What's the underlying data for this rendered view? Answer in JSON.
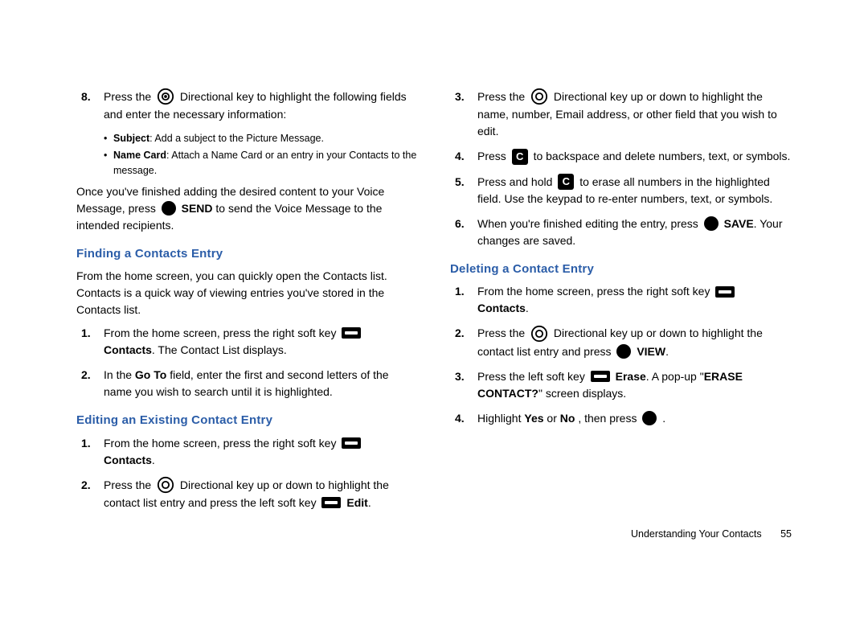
{
  "left": {
    "step8": {
      "num": "8.",
      "t1": "Press the ",
      "t2": " Directional key to highlight the following fields and enter the necessary information:"
    },
    "bullets": {
      "subj_b": "Subject",
      "subj": ": Add a subject to the Picture Message.",
      "nc_b": "Name Card",
      "nc": ": Attach a Name Card or an entry in your Contacts to the message."
    },
    "afterBullets": {
      "t1": "Once you've finished adding the desired content to your Voice Message, press ",
      "send": "SEND",
      "t2": " to send the Voice Message to the intended recipients."
    },
    "h1": "Finding a Contacts Entry",
    "p1": "From the home screen, you can quickly open the Contacts list. Contacts is a quick way of viewing entries you've stored in the Contacts list.",
    "find1": {
      "num": "1.",
      "t1": "From the home screen, press the right soft key ",
      "contacts": "Contacts",
      "t2": ". The Contact List displays."
    },
    "find2": {
      "num": "2.",
      "t1": "In the ",
      "goto": "Go To",
      "t2": " field, enter the first and second letters of the name you wish to search until it is highlighted."
    },
    "h2": "Editing an Existing Contact Entry",
    "edit1": {
      "num": "1.",
      "t1": "From the home screen, press the right soft key ",
      "contacts": "Contacts",
      "t2": "."
    },
    "edit2": {
      "num": "2.",
      "t1": "Press the ",
      "t2": " Directional key up or down to highlight the contact list entry and press the left soft key ",
      "edit": "Edit",
      "t3": "."
    }
  },
  "right": {
    "r3": {
      "num": "3.",
      "t1": "Press the ",
      "t2": " Directional key up or down to highlight the name, number, Email address, or other field that you wish to edit."
    },
    "r4": {
      "num": "4.",
      "t1": "Press ",
      "t2": " to backspace and delete numbers, text, or symbols."
    },
    "r5": {
      "num": "5.",
      "t1": "Press and hold ",
      "t2": " to erase all numbers in the highlighted field. Use the keypad to re-enter numbers, text, or symbols."
    },
    "r6": {
      "num": "6.",
      "t1": "When you're finished editing the entry, press ",
      "save": "SAVE",
      "t2": ". Your changes are saved."
    },
    "h3": "Deleting a Contact Entry",
    "d1": {
      "num": "1.",
      "t1": "From the home screen, press the right soft key ",
      "contacts": "Contacts",
      "t2": "."
    },
    "d2": {
      "num": "2.",
      "t1": "Press the ",
      "t2": " Directional key up or down to highlight the contact list entry and press ",
      "view": "VIEW",
      "t3": "."
    },
    "d3": {
      "num": "3.",
      "t1": "Press the left soft key ",
      "erase": "Erase",
      "t2": ". A pop-up \"",
      "eraseq": "ERASE CONTACT?",
      "t3": "\" screen displays."
    },
    "d4": {
      "num": "4.",
      "t1": "Highlight ",
      "yes": "Yes",
      "or": " or ",
      "no": "No",
      "t2": ", then press ",
      "t3": "."
    }
  },
  "footer": {
    "section": "Understanding Your Contacts",
    "page": "55"
  }
}
